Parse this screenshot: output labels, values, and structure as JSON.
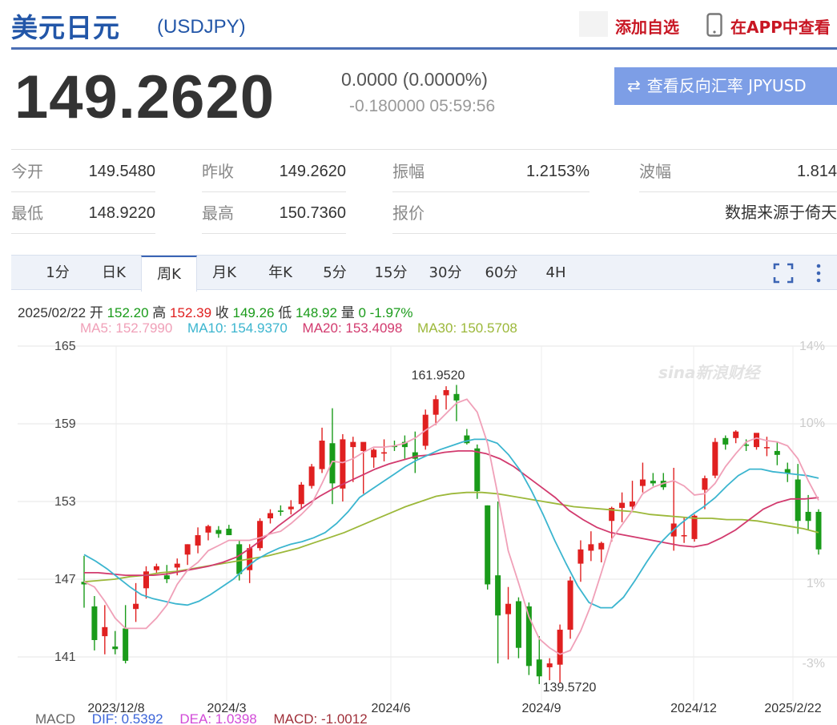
{
  "header": {
    "title": "美元日元",
    "code": "(USDJPY)",
    "add_watch": "添加自选",
    "app_view": "在APP中查看"
  },
  "quote": {
    "price": "149.2620",
    "change": "0.0000 (0.0000%)",
    "sub": "-0.180000 05:59:56",
    "reverse_btn": "查看反向汇率 JPYUSD"
  },
  "stats": {
    "open_k": "今开",
    "open_v": "149.5480",
    "prev_k": "昨收",
    "prev_v": "149.2620",
    "amp_k": "振幅",
    "amp_v": "1.2153%",
    "wave_k": "波幅",
    "wave_v": "1.814",
    "low_k": "最低",
    "low_v": "148.9220",
    "high_k": "最高",
    "high_v": "150.7360",
    "quote_k": "报价",
    "source_v": "数据来源于倚天"
  },
  "tabs": [
    "1分",
    "日K",
    "周K",
    "月K",
    "年K",
    "5分",
    "15分",
    "30分",
    "60分",
    "4H"
  ],
  "active_tab": "周K",
  "bar_info": {
    "date": "2025/02/22",
    "open_k": "开",
    "open_v": "152.20",
    "high_k": "高",
    "high_v": "152.39",
    "close_k": "收",
    "close_v": "149.26",
    "low_k": "低",
    "low_v": "148.92",
    "vol_k": "量",
    "vol_v": "0",
    "pct": "-1.97%"
  },
  "ma": {
    "ma5": "MA5: 152.7990",
    "ma10": "MA10: 154.9370",
    "ma20": "MA20: 153.4098",
    "ma30": "MA30: 150.5708"
  },
  "macd": {
    "label": "MACD",
    "dif": "DIF: 0.5392",
    "dea": "DEA: 1.0398",
    "macd": "MACD: -1.0012"
  },
  "colors": {
    "up": "#e02020",
    "down": "#1a9b1a",
    "ma5": "#f0a0b8",
    "ma10": "#3bb5cf",
    "ma20": "#d23a6e",
    "ma30": "#9cb83a",
    "brand": "#2256a8"
  },
  "chart_data": {
    "type": "candlestick",
    "y_ticks": [
      "165",
      "159",
      "153",
      "147",
      "141"
    ],
    "pct_ticks": [
      "14%",
      "10%",
      "1%",
      "-3%"
    ],
    "x_ticks": [
      "2023/12/8",
      "2024/3",
      "2024/6",
      "2024/9",
      "2024/12",
      "2025/2/22"
    ],
    "ylim": [
      141,
      165
    ],
    "annotations": [
      {
        "text": "161.9520",
        "value": 161.952
      },
      {
        "text": "139.5720",
        "value": 139.572
      }
    ],
    "watermark": "sina新浪财经",
    "candles": [
      [
        146.8,
        148.8,
        144.8,
        146.6
      ],
      [
        144.9,
        145.7,
        141.5,
        142.3
      ],
      [
        142.6,
        145.0,
        141.2,
        143.3
      ],
      [
        141.8,
        143.0,
        141.2,
        141.6
      ],
      [
        143.2,
        145.0,
        140.5,
        140.7
      ],
      [
        144.7,
        146.7,
        143.7,
        145.1
      ],
      [
        146.3,
        148.0,
        145.5,
        147.6
      ],
      [
        147.7,
        148.2,
        147.5,
        148.0
      ],
      [
        147.3,
        148.1,
        146.7,
        147.0
      ],
      [
        147.9,
        148.6,
        147.3,
        148.2
      ],
      [
        148.9,
        149.7,
        148.1,
        149.7
      ],
      [
        149.6,
        151.0,
        149.0,
        150.4
      ],
      [
        150.6,
        151.2,
        150.0,
        151.1
      ],
      [
        150.8,
        151.1,
        150.2,
        150.5
      ],
      [
        150.9,
        151.2,
        150.4,
        150.4
      ],
      [
        149.7,
        150.0,
        146.9,
        147.4
      ],
      [
        147.7,
        149.7,
        146.7,
        149.4
      ],
      [
        149.4,
        151.7,
        149.2,
        151.5
      ],
      [
        151.7,
        152.4,
        151.3,
        152.1
      ],
      [
        152.3,
        152.7,
        151.9,
        152.2
      ],
      [
        152.4,
        153.1,
        152.0,
        152.6
      ],
      [
        152.8,
        154.5,
        152.4,
        154.3
      ],
      [
        154.2,
        155.9,
        154.0,
        155.7
      ],
      [
        155.5,
        158.7,
        155.2,
        157.7
      ],
      [
        157.5,
        160.2,
        152.8,
        154.4
      ],
      [
        154.0,
        158.2,
        153.0,
        157.8
      ],
      [
        157.2,
        158.0,
        154.5,
        157.6
      ],
      [
        156.9,
        157.5,
        153.6,
        157.6
      ],
      [
        156.4,
        157.1,
        155.6,
        157.0
      ],
      [
        156.7,
        157.8,
        156.1,
        156.8
      ],
      [
        157.3,
        157.7,
        156.9,
        157.2
      ],
      [
        157.6,
        158.1,
        156.3,
        157.2
      ],
      [
        156.8,
        158.4,
        155.2,
        156.3
      ],
      [
        157.3,
        160.1,
        157.0,
        159.7
      ],
      [
        159.7,
        161.2,
        158.9,
        160.9
      ],
      [
        161.2,
        161.9,
        160.1,
        161.6
      ],
      [
        161.3,
        162.0,
        159.2,
        160.8
      ],
      [
        158.1,
        158.6,
        157.4,
        157.5
      ],
      [
        157.1,
        157.4,
        153.2,
        153.8
      ],
      [
        152.7,
        152.7,
        146.2,
        146.6
      ],
      [
        147.3,
        153.0,
        140.5,
        144.2
      ],
      [
        144.3,
        146.4,
        140.8,
        145.1
      ],
      [
        145.3,
        145.6,
        140.9,
        141.7
      ],
      [
        144.9,
        145.2,
        139.6,
        140.3
      ],
      [
        140.8,
        142.6,
        138.9,
        139.5
      ],
      [
        140.2,
        140.9,
        139.2,
        140.5
      ],
      [
        140.4,
        143.5,
        139.0,
        143.1
      ],
      [
        143.1,
        147.2,
        142.4,
        146.9
      ],
      [
        148.2,
        150.0,
        146.8,
        149.3
      ],
      [
        149.2,
        150.7,
        148.4,
        149.7
      ],
      [
        149.3,
        149.9,
        148.3,
        149.8
      ],
      [
        151.5,
        152.6,
        149.9,
        152.5
      ],
      [
        152.5,
        153.7,
        151.4,
        152.9
      ],
      [
        152.6,
        154.6,
        152.3,
        153.0
      ],
      [
        154.2,
        156.0,
        153.7,
        154.7
      ],
      [
        154.6,
        155.2,
        154.2,
        154.4
      ],
      [
        154.6,
        155.2,
        153.9,
        154.1
      ],
      [
        150.3,
        155.6,
        149.2,
        151.3
      ],
      [
        150.4,
        151.8,
        149.8,
        150.4
      ],
      [
        150.1,
        152.0,
        149.9,
        151.9
      ],
      [
        153.9,
        155.0,
        152.4,
        154.8
      ],
      [
        155.0,
        157.9,
        154.8,
        157.6
      ],
      [
        157.9,
        158.1,
        157.0,
        157.4
      ],
      [
        157.9,
        158.5,
        157.5,
        158.4
      ],
      [
        157.4,
        157.8,
        156.9,
        157.3
      ],
      [
        157.2,
        158.0,
        157.0,
        158.3
      ],
      [
        157.2,
        158.0,
        156.5,
        157.2
      ],
      [
        156.9,
        157.6,
        155.8,
        156.6
      ],
      [
        155.5,
        156.0,
        154.5,
        155.2
      ],
      [
        154.7,
        155.9,
        150.5,
        151.5
      ],
      [
        152.2,
        153.5,
        150.8,
        151.5
      ],
      [
        152.2,
        152.4,
        148.9,
        149.3
      ]
    ],
    "ma5": [
      [
        146.8
      ],
      [
        146.4
      ],
      [
        145.3
      ],
      [
        144.0
      ],
      [
        143.2
      ],
      [
        143.2
      ],
      [
        143.2
      ],
      [
        144.0
      ],
      [
        145.0
      ],
      [
        146.6
      ],
      [
        147.7
      ],
      [
        148.3
      ],
      [
        149.2
      ],
      [
        149.6
      ],
      [
        150.0
      ],
      [
        150.0
      ],
      [
        150.0
      ],
      [
        150.2
      ],
      [
        150.5
      ],
      [
        150.7
      ],
      [
        151.3
      ],
      [
        152.0
      ],
      [
        152.8
      ],
      [
        154.4
      ],
      [
        156.1
      ],
      [
        156.0
      ],
      [
        156.3
      ],
      [
        156.8
      ],
      [
        157.2
      ],
      [
        157.2
      ],
      [
        157.3
      ],
      [
        157.5
      ],
      [
        157.9
      ],
      [
        158.5
      ],
      [
        159.0
      ],
      [
        159.8
      ],
      [
        160.6
      ],
      [
        160.9
      ],
      [
        159.9
      ],
      [
        157.5
      ],
      [
        153.5
      ],
      [
        149.2
      ],
      [
        146.7
      ],
      [
        144.1
      ],
      [
        142.4
      ],
      [
        141.7
      ],
      [
        141.2
      ],
      [
        141.5
      ],
      [
        143.0
      ],
      [
        145.0
      ],
      [
        147.5
      ],
      [
        150.1
      ],
      [
        151.2
      ],
      [
        152.3
      ],
      [
        153.6
      ],
      [
        154.1
      ],
      [
        154.4
      ],
      [
        154.6
      ],
      [
        154.2
      ],
      [
        153.5
      ],
      [
        153.6
      ],
      [
        154.4
      ],
      [
        155.7
      ],
      [
        156.7
      ],
      [
        157.6
      ],
      [
        157.9
      ],
      [
        157.7
      ],
      [
        157.6
      ],
      [
        157.3
      ],
      [
        156.3
      ],
      [
        154.6
      ],
      [
        153.1
      ]
    ],
    "ma10": [
      [
        148.9
      ],
      [
        148.4
      ],
      [
        147.8
      ],
      [
        147.1
      ],
      [
        146.4
      ],
      [
        145.8
      ],
      [
        145.5
      ],
      [
        145.3
      ],
      [
        145.1
      ],
      [
        145.0
      ],
      [
        145.3
      ],
      [
        145.8
      ],
      [
        146.4
      ],
      [
        147.0
      ],
      [
        147.8
      ],
      [
        148.5
      ],
      [
        149.0
      ],
      [
        149.4
      ],
      [
        149.7
      ],
      [
        149.9
      ],
      [
        150.2
      ],
      [
        150.6
      ],
      [
        151.3
      ],
      [
        152.2
      ],
      [
        153.3
      ],
      [
        153.9
      ],
      [
        154.5
      ],
      [
        155.1
      ],
      [
        155.7
      ],
      [
        156.2
      ],
      [
        156.6
      ],
      [
        157.0
      ],
      [
        157.3
      ],
      [
        157.6
      ],
      [
        157.8
      ],
      [
        157.8
      ],
      [
        157.5
      ],
      [
        156.6
      ],
      [
        155.4
      ],
      [
        153.8
      ],
      [
        152.0
      ],
      [
        150.0
      ],
      [
        148.2
      ],
      [
        146.5
      ],
      [
        145.2
      ],
      [
        144.8
      ],
      [
        144.8
      ],
      [
        145.6
      ],
      [
        146.9
      ],
      [
        148.3
      ],
      [
        149.6
      ],
      [
        150.5
      ],
      [
        151.3
      ],
      [
        152.0
      ],
      [
        152.6
      ],
      [
        153.3
      ],
      [
        154.2
      ],
      [
        155.0
      ],
      [
        155.5
      ],
      [
        155.5
      ],
      [
        155.3
      ],
      [
        155.2
      ],
      [
        155.1
      ],
      [
        155.0
      ],
      [
        154.8
      ]
    ],
    "ma20": [
      [
        147.5
      ],
      [
        147.5
      ],
      [
        147.4
      ],
      [
        147.3
      ],
      [
        147.3
      ],
      [
        147.3
      ],
      [
        147.4
      ],
      [
        147.6
      ],
      [
        147.8
      ],
      [
        148.0
      ],
      [
        148.3
      ],
      [
        148.7
      ],
      [
        149.4
      ],
      [
        150.2
      ],
      [
        151.1
      ],
      [
        151.9
      ],
      [
        152.7
      ],
      [
        153.4
      ],
      [
        154.0
      ],
      [
        154.5
      ],
      [
        155.0
      ],
      [
        155.5
      ],
      [
        155.9
      ],
      [
        156.2
      ],
      [
        156.5
      ],
      [
        156.6
      ],
      [
        156.8
      ],
      [
        156.9
      ],
      [
        156.9
      ],
      [
        156.7
      ],
      [
        156.3
      ],
      [
        155.7
      ],
      [
        154.9
      ],
      [
        154.1
      ],
      [
        153.3
      ],
      [
        152.3
      ],
      [
        151.6
      ],
      [
        151.0
      ],
      [
        150.6
      ],
      [
        150.4
      ],
      [
        150.2
      ],
      [
        150.0
      ],
      [
        149.8
      ],
      [
        149.6
      ],
      [
        149.5
      ],
      [
        149.7
      ],
      [
        150.2
      ],
      [
        150.8
      ],
      [
        151.6
      ],
      [
        152.4
      ],
      [
        152.9
      ],
      [
        153.2
      ],
      [
        153.2
      ],
      [
        153.3
      ]
    ],
    "ma30": [
      [
        146.8
      ],
      [
        146.9
      ],
      [
        147.0
      ],
      [
        147.2
      ],
      [
        147.3
      ],
      [
        147.5
      ],
      [
        147.6
      ],
      [
        147.8
      ],
      [
        148.0
      ],
      [
        148.2
      ],
      [
        148.4
      ],
      [
        148.6
      ],
      [
        148.8
      ],
      [
        149.1
      ],
      [
        149.4
      ],
      [
        149.8
      ],
      [
        150.2
      ],
      [
        150.6
      ],
      [
        151.1
      ],
      [
        151.6
      ],
      [
        152.1
      ],
      [
        152.6
      ],
      [
        153.0
      ],
      [
        153.4
      ],
      [
        153.6
      ],
      [
        153.7
      ],
      [
        153.7
      ],
      [
        153.6
      ],
      [
        153.4
      ],
      [
        153.2
      ],
      [
        153.0
      ],
      [
        152.8
      ],
      [
        152.6
      ],
      [
        152.5
      ],
      [
        152.4
      ],
      [
        152.3
      ],
      [
        152.2
      ],
      [
        152.0
      ],
      [
        151.9
      ],
      [
        151.8
      ],
      [
        151.7
      ],
      [
        151.7
      ],
      [
        151.6
      ],
      [
        151.6
      ],
      [
        151.5
      ],
      [
        151.3
      ],
      [
        151.1
      ],
      [
        150.9
      ],
      [
        150.6
      ]
    ]
  }
}
